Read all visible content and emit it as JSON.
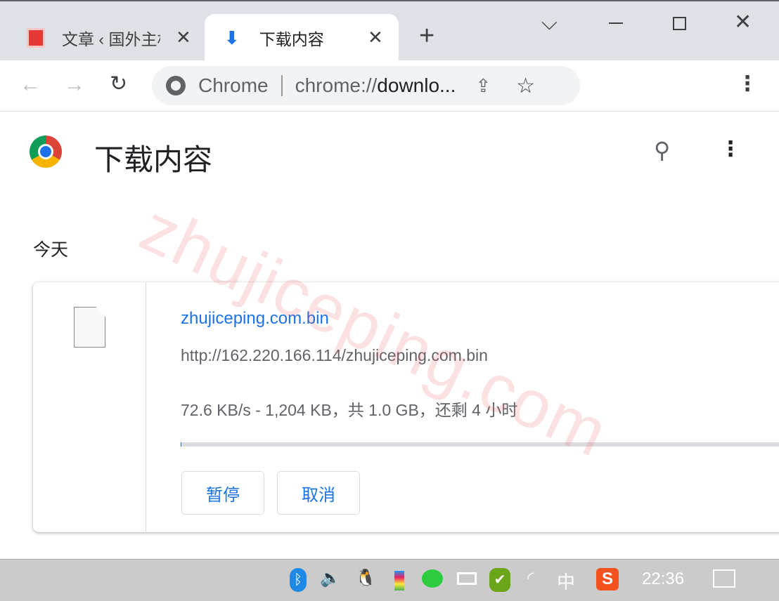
{
  "tabs": [
    {
      "label": "文章 ‹ 国外主机",
      "icon": "site-favicon"
    },
    {
      "label": "下载内容",
      "icon": "download-icon",
      "active": true
    }
  ],
  "new_tab": "+",
  "window_controls": [
    "chevron-down-icon",
    "minimize-icon",
    "maximize-icon",
    "close-icon"
  ],
  "omnibox": {
    "site": "Chrome",
    "url_prefix": "chrome://",
    "url_rest": "downlo..."
  },
  "page": {
    "title": "下载内容",
    "section": "今天"
  },
  "download": {
    "filename": "zhujiceping.com.bin",
    "url": "http://162.220.166.114/zhujiceping.com.bin",
    "status": "72.6 KB/s - 1,204 KB，共 1.0 GB，还剩 4 小时",
    "progress_fraction": 0.001,
    "pause": "暂停",
    "cancel": "取消"
  },
  "watermark": "zhujiceping.com",
  "taskbar": {
    "ime": "中",
    "time": "22:36"
  },
  "colors": {
    "accent": "#1a73e8",
    "tabbar": "#dee1e6",
    "progress_track": "#dadce0"
  }
}
